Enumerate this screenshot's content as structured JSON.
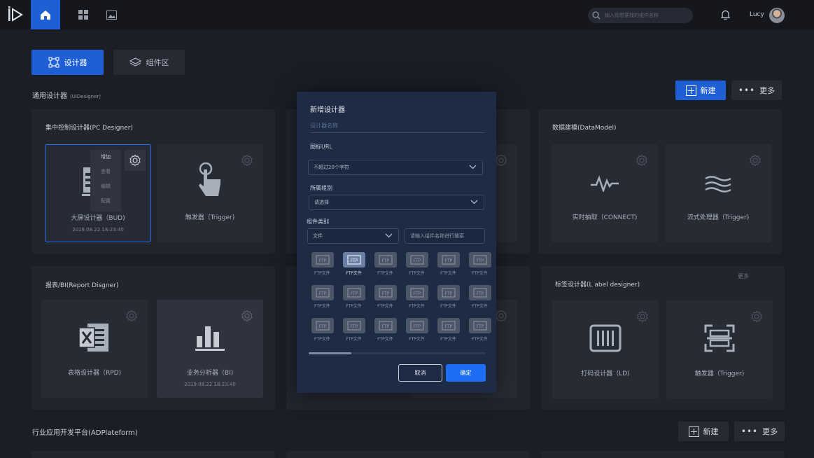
{
  "user": {
    "name": "Lucy"
  },
  "search": {
    "placeholder": "输入你想要找的组件名称"
  },
  "tabs": [
    {
      "label": "设计器"
    },
    {
      "label": "组件区"
    }
  ],
  "section1": {
    "title": "通用设计器",
    "subtitle": "(UIDesigner)",
    "new_label": "新建",
    "more_label": "更多"
  },
  "section2": {
    "title": "行业应用开发平台(ADPlateform)",
    "new_label": "新建",
    "more_label": "更多"
  },
  "panels": {
    "pc": {
      "title": "集中控制设计器(PC Designer)",
      "cards": [
        {
          "label": "大屏设计器（BUD)",
          "date": "2019.08.22 18:23:40"
        },
        {
          "label": "触发器（Trigger)"
        }
      ],
      "menu": [
        "增加",
        "查看",
        "编辑",
        "配置"
      ]
    },
    "datamodel": {
      "title": "数据建模(DataModel)",
      "cards": [
        {
          "label": "实时抽取（CONNECT)"
        },
        {
          "label": "流式处理器（Trigger)"
        }
      ]
    },
    "report": {
      "title": "报表/BI(Report Disgner)",
      "cards": [
        {
          "label": "表格设计器（RPD)"
        },
        {
          "label": "业务分析器（BI)",
          "date": "2019.08.22 18:23:40"
        }
      ]
    },
    "label": {
      "title": "标签设计器(L abel designer)",
      "more": "更多",
      "cards": [
        {
          "label": "打码设计器（LD)"
        },
        {
          "label": "触发器（Trigger)"
        }
      ]
    }
  },
  "modal": {
    "title": "新增设计器",
    "name_placeholder": "设计器名称",
    "icon_url_label": "图标URL",
    "icon_url_placeholder": "不超过20个字符",
    "group_label": "所属组别",
    "group_placeholder": "请选择",
    "type_label": "组件类别",
    "type_value": "文件",
    "type_search_placeholder": "请输入组件名称进行搜索",
    "grid_item_label": "FTP文件",
    "grid_icon_text": "FTP",
    "progress": 0.24,
    "cancel_label": "取消",
    "ok_label": "确定"
  },
  "colors": {
    "accent": "#1f5fd6",
    "modal_bg": "#1d2b45",
    "ok_button": "#1e6ef5"
  }
}
